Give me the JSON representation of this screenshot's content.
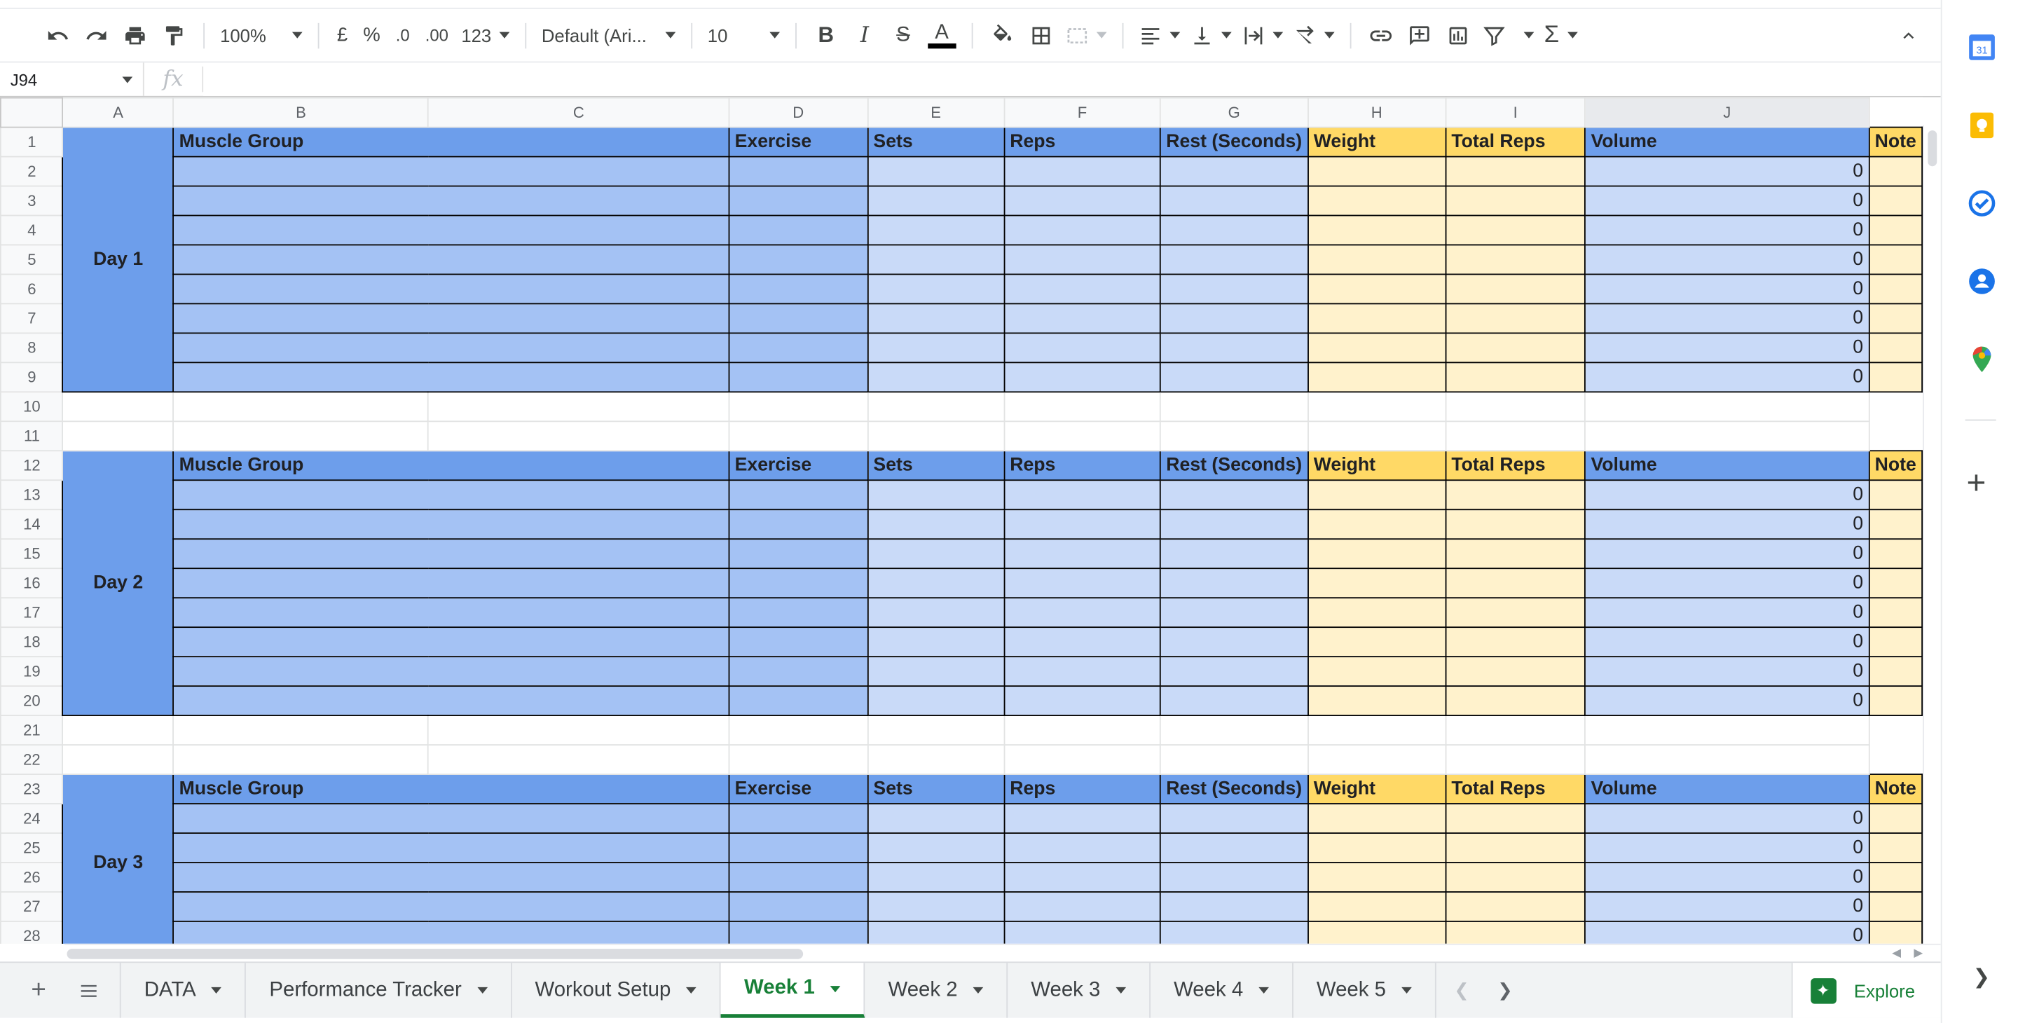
{
  "toolbar": {
    "zoom": "100%",
    "currency": "£",
    "percent": "%",
    "decrease_decimal": ".0",
    "increase_decimal": ".00",
    "number_format": "123",
    "font": "Default (Ari...",
    "font_size": "10"
  },
  "formula_bar": {
    "name_box": "J94",
    "fx": "fx",
    "value": ""
  },
  "grid": {
    "columns": [
      "A",
      "B",
      "C",
      "D",
      "E",
      "F",
      "G",
      "H",
      "I",
      "J"
    ],
    "selected_column": "J",
    "headers": [
      "Muscle Group",
      "Exercise",
      "Sets",
      "Reps",
      "Rest (Seconds)",
      "Weight",
      "Total Reps",
      "Volume",
      "Note"
    ],
    "blocks": [
      {
        "label": "Day 1",
        "header_row": 1,
        "rows": [
          {
            "row": 2,
            "volume": "0"
          },
          {
            "row": 3,
            "volume": "0"
          },
          {
            "row": 4,
            "volume": "0"
          },
          {
            "row": 5,
            "volume": "0"
          },
          {
            "row": 6,
            "volume": "0"
          },
          {
            "row": 7,
            "volume": "0"
          },
          {
            "row": 8,
            "volume": "0"
          },
          {
            "row": 9,
            "volume": "0"
          }
        ]
      },
      {
        "label": "Day 2",
        "header_row": 12,
        "rows": [
          {
            "row": 13,
            "volume": "0"
          },
          {
            "row": 14,
            "volume": "0"
          },
          {
            "row": 15,
            "volume": "0"
          },
          {
            "row": 16,
            "volume": "0"
          },
          {
            "row": 17,
            "volume": "0"
          },
          {
            "row": 18,
            "volume": "0"
          },
          {
            "row": 19,
            "volume": "0"
          },
          {
            "row": 20,
            "volume": "0"
          }
        ]
      },
      {
        "label": "Day 3",
        "header_row": 23,
        "rows": [
          {
            "row": 24,
            "volume": "0"
          },
          {
            "row": 25,
            "volume": "0"
          },
          {
            "row": 26,
            "volume": "0"
          },
          {
            "row": 27,
            "volume": "0"
          },
          {
            "row": 28,
            "volume": "0"
          }
        ]
      }
    ],
    "empty_rows": [
      10,
      11,
      21,
      22
    ]
  },
  "tabs": {
    "sheets": [
      {
        "label": "DATA",
        "active": false
      },
      {
        "label": "Performance Tracker",
        "active": false
      },
      {
        "label": "Workout Setup",
        "active": false
      },
      {
        "label": "Week 1",
        "active": true
      },
      {
        "label": "Week 2",
        "active": false
      },
      {
        "label": "Week 3",
        "active": false
      },
      {
        "label": "Week 4",
        "active": false
      },
      {
        "label": "Week 5",
        "active": false
      }
    ],
    "explore_label": "Explore"
  },
  "side_panel": {
    "calendar_day": "31",
    "icons": [
      "calendar-icon",
      "keep-icon",
      "tasks-icon",
      "contacts-icon",
      "maps-icon"
    ]
  },
  "colors": {
    "header_blue": "#6d9eeb",
    "cell_mid_blue": "#a4c2f4",
    "cell_light_blue": "#c9daf8",
    "header_yellow": "#ffd966",
    "cell_light_yellow": "#fff2cc",
    "active_tab_green": "#188038"
  }
}
